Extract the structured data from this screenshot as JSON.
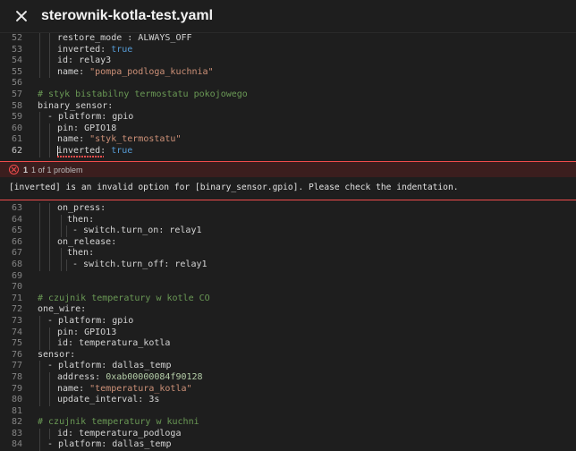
{
  "header": {
    "title": "sterownik-kotla-test.yaml"
  },
  "top_lines": [
    {
      "num": "52",
      "parts": [
        [
          "k",
          "restore_mode : ALWAYS_OFF"
        ]
      ],
      "indent": 2
    },
    {
      "num": "53",
      "parts": [
        [
          "k",
          "inverted: "
        ],
        [
          "b",
          "true"
        ]
      ],
      "indent": 2
    },
    {
      "num": "54",
      "parts": [
        [
          "k",
          "id: relay3"
        ]
      ],
      "indent": 2
    },
    {
      "num": "55",
      "parts": [
        [
          "k",
          "name: "
        ],
        [
          "s",
          "\"pompa_podloga_kuchnia\""
        ]
      ],
      "indent": 2
    },
    {
      "num": "56",
      "parts": [],
      "indent": 0
    },
    {
      "num": "57",
      "parts": [
        [
          "c",
          "# styk bistabilny termostatu pokojowego"
        ]
      ],
      "indent": 0
    },
    {
      "num": "58",
      "parts": [
        [
          "k",
          "binary_sensor:"
        ]
      ],
      "indent": 0
    },
    {
      "num": "59",
      "parts": [
        [
          "k",
          "- platform: gpio"
        ]
      ],
      "indent": 1
    },
    {
      "num": "60",
      "parts": [
        [
          "k",
          "pin: GPIO18"
        ]
      ],
      "indent": 2
    },
    {
      "num": "61",
      "parts": [
        [
          "k",
          "name: "
        ],
        [
          "s",
          "\"styk_termostatu\""
        ]
      ],
      "indent": 2
    },
    {
      "num": "62",
      "parts": [
        [
          "k",
          "inverted: "
        ],
        [
          "b",
          "true"
        ]
      ],
      "indent": 2,
      "active": true
    }
  ],
  "problem": {
    "count": "1",
    "summary": "1 of 1 problem",
    "message": "[inverted] is an invalid option for [binary_sensor.gpio]. Please check the indentation."
  },
  "bottom_lines": [
    {
      "num": "63",
      "parts": [
        [
          "k",
          "on_press:"
        ]
      ],
      "indent": 2
    },
    {
      "num": "64",
      "parts": [
        [
          "k",
          "then:"
        ]
      ],
      "indent": 3
    },
    {
      "num": "65",
      "parts": [
        [
          "k",
          "- switch.turn_on: relay1"
        ]
      ],
      "indent": 4
    },
    {
      "num": "66",
      "parts": [
        [
          "k",
          "on_release:"
        ]
      ],
      "indent": 2
    },
    {
      "num": "67",
      "parts": [
        [
          "k",
          "then:"
        ]
      ],
      "indent": 3
    },
    {
      "num": "68",
      "parts": [
        [
          "k",
          "- switch.turn_off: relay1"
        ]
      ],
      "indent": 4
    },
    {
      "num": "69",
      "parts": [],
      "indent": 0
    },
    {
      "num": "70",
      "parts": [],
      "indent": 0
    },
    {
      "num": "71",
      "parts": [
        [
          "c",
          "# czujnik temperatury w kotle CO"
        ]
      ],
      "indent": 0
    },
    {
      "num": "72",
      "parts": [
        [
          "k",
          "one_wire:"
        ]
      ],
      "indent": 0
    },
    {
      "num": "73",
      "parts": [
        [
          "k",
          "- platform: gpio"
        ]
      ],
      "indent": 1
    },
    {
      "num": "74",
      "parts": [
        [
          "k",
          "pin: GPIO13"
        ]
      ],
      "indent": 2
    },
    {
      "num": "75",
      "parts": [
        [
          "k",
          "id: temperatura_kotla"
        ]
      ],
      "indent": 2
    },
    {
      "num": "76",
      "parts": [
        [
          "k",
          "sensor:"
        ]
      ],
      "indent": 0
    },
    {
      "num": "77",
      "parts": [
        [
          "k",
          "- platform: dallas_temp"
        ]
      ],
      "indent": 1
    },
    {
      "num": "78",
      "parts": [
        [
          "k",
          "address: "
        ],
        [
          "n",
          "0xab00000084f90128"
        ]
      ],
      "indent": 2
    },
    {
      "num": "79",
      "parts": [
        [
          "k",
          "name: "
        ],
        [
          "s",
          "\"temperatura_kotla\""
        ]
      ],
      "indent": 2
    },
    {
      "num": "80",
      "parts": [
        [
          "k",
          "update_interval: 3s"
        ]
      ],
      "indent": 2
    },
    {
      "num": "81",
      "parts": [],
      "indent": 0
    },
    {
      "num": "82",
      "parts": [
        [
          "c",
          "# czujnik temperatury w kuchni"
        ]
      ],
      "indent": 0
    },
    {
      "num": "83",
      "parts": [
        [
          "k",
          "id: temperatura_podloga"
        ]
      ],
      "indent": 2
    },
    {
      "num": "84",
      "parts": [
        [
          "k",
          "- platform: dallas_temp"
        ]
      ],
      "indent": 1
    }
  ]
}
